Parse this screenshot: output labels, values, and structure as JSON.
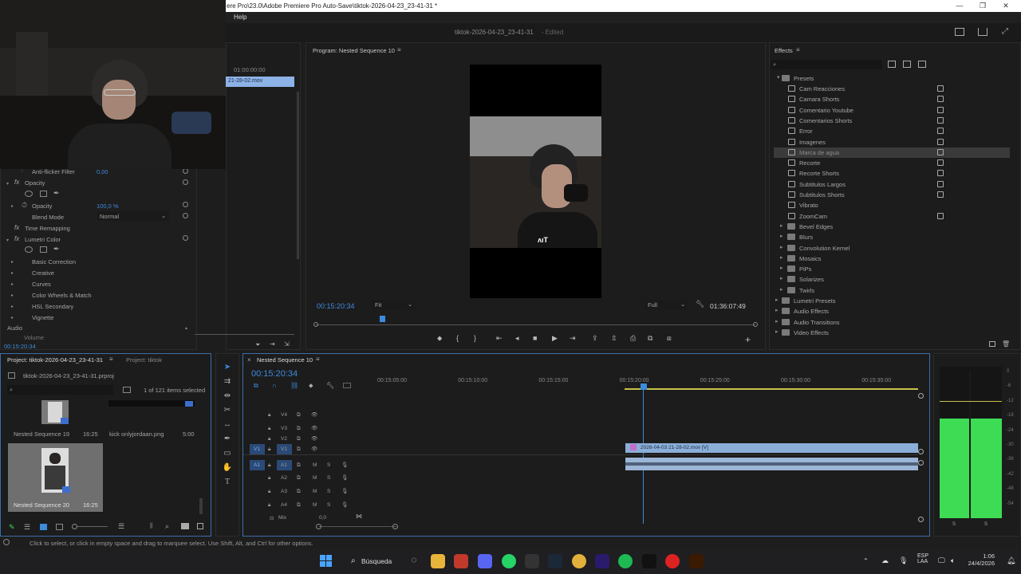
{
  "window": {
    "title": "ere Pro\\23.0\\Adobe Premiere Pro Auto-Save\\tiktok-2026-04-23_23-41-31 *",
    "menu_help": "Help",
    "document": "tiktok-2026-04-23_23-41-31",
    "edited": "- Edited"
  },
  "source_panel": {
    "timecode": "01:00:00:00",
    "clip": "21-28-02.mov"
  },
  "effect_controls": {
    "anti_flicker": "Anti-flicker Filter",
    "anti_flicker_value": "0,00",
    "opacity_group": "Opacity",
    "opacity_label": "Opacity",
    "opacity_value": "100,0 %",
    "blend_mode_label": "Blend Mode",
    "blend_mode_value": "Normal",
    "time_remapping": "Time Remapping",
    "lumetri": "Lumetri Color",
    "sections": [
      "Basic Correction",
      "Creative",
      "Curves",
      "Color Wheels & Match",
      "HSL Secondary",
      "Vignette"
    ],
    "audio": "Audio",
    "volume": "Volume",
    "timecode": "00:15:20:34"
  },
  "program": {
    "title": "Program: Nested Sequence 10",
    "timecode": "00:15:20:34",
    "fit": "Fit",
    "quality": "Full",
    "duration": "01:36:07:49"
  },
  "effects": {
    "title": "Effects",
    "presets_folder": "Presets",
    "presets": [
      {
        "name": "Cam Reacciones",
        "badge": true,
        "selected": false
      },
      {
        "name": "Camara Shorts",
        "badge": true,
        "selected": false
      },
      {
        "name": "Comentario Youtube",
        "badge": true,
        "selected": false
      },
      {
        "name": "Comentarios Shorts",
        "badge": true,
        "selected": false
      },
      {
        "name": "Error",
        "badge": true,
        "selected": false
      },
      {
        "name": "Imagenes",
        "badge": true,
        "selected": false
      },
      {
        "name": "Marca de agua",
        "badge": true,
        "selected": true
      },
      {
        "name": "Recorte",
        "badge": true,
        "selected": false
      },
      {
        "name": "Recorte Shorts",
        "badge": true,
        "selected": false
      },
      {
        "name": "Subtitulos Largos",
        "badge": true,
        "selected": false
      },
      {
        "name": "Subtitulos Shorts",
        "badge": true,
        "selected": false
      },
      {
        "name": "Vibrato",
        "badge": false,
        "selected": false
      },
      {
        "name": "ZoomCam",
        "badge": true,
        "selected": false
      }
    ],
    "preset_subfolders": [
      "Bevel Edges",
      "Blurs",
      "Convolution Kernel",
      "Mosaics",
      "PiPs",
      "Solarizes",
      "Twirls"
    ],
    "top_folders": [
      "Lumetri Presets",
      "Audio Effects",
      "Audio Transitions",
      "Video Effects"
    ]
  },
  "project": {
    "tab_active": "Project: tiktok-2026-04-23_23-41-31",
    "tab_other": "Project: tiktok",
    "file": "tiktok-2026-04-23_23-41-31.prproj",
    "selection": "1 of 121 items selected",
    "items": [
      {
        "name": "Nested Sequence 19",
        "duration": "16:25"
      },
      {
        "name": "kick onlyjordaan.png",
        "duration": "5:00"
      },
      {
        "name": "Nested Sequence 20",
        "duration": "16:25"
      }
    ]
  },
  "timeline": {
    "tab": "Nested Sequence 10",
    "timecode": "00:15:20:34",
    "ticks": [
      "00:15:05:00",
      "00:15:10:00",
      "00:15:15:00",
      "00:15:20:00",
      "00:15:25:00",
      "00:15:30:00",
      "00:15:35:00"
    ],
    "video_tracks": [
      "V4",
      "V3",
      "V2",
      "V1"
    ],
    "audio_tracks": [
      "A1",
      "A2",
      "A3",
      "A4"
    ],
    "source_v": "V1",
    "source_a": "A1",
    "mix": "Mix",
    "mix_value": "0,0",
    "clip_name": "2026-04-03 21-28-02.mov [V]",
    "m": "M",
    "s": "S"
  },
  "meters": {
    "scale": [
      "0",
      "-6",
      "-12",
      "-18",
      "-24",
      "-30",
      "-36",
      "-42",
      "-48",
      "-54"
    ],
    "bottom": [
      "S",
      "S"
    ],
    "level_db": -12
  },
  "status_bar": "Click to select, or click in empty space and drag to marquee select. Use Shift, Alt, and Ctrl for other options.",
  "taskbar": {
    "search": "Búsqueda",
    "lang": "ESP",
    "lang2": "LAA",
    "time": "1:06",
    "date": "24/4/2026"
  },
  "colors": {
    "accent": "#3c8bdc",
    "clip_video": "#8aaed8",
    "clip_audio": "#9bb6d6",
    "meter": "#3ddc54"
  }
}
